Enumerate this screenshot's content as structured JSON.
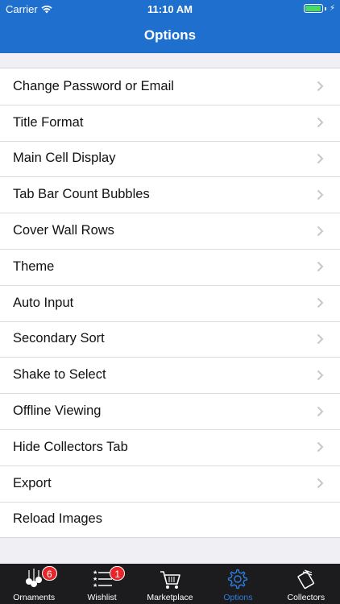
{
  "status_bar": {
    "carrier": "Carrier",
    "time": "11:10 AM",
    "battery_level": 0.95
  },
  "nav": {
    "title": "Options"
  },
  "options": [
    {
      "label": "Change Password or Email",
      "chevron": true
    },
    {
      "label": "Title Format",
      "chevron": true
    },
    {
      "label": "Main Cell Display",
      "chevron": true
    },
    {
      "label": "Tab Bar Count Bubbles",
      "chevron": true
    },
    {
      "label": "Cover Wall Rows",
      "chevron": true
    },
    {
      "label": "Theme",
      "chevron": true
    },
    {
      "label": "Auto Input",
      "chevron": true
    },
    {
      "label": "Secondary Sort",
      "chevron": true
    },
    {
      "label": "Shake to Select",
      "chevron": true
    },
    {
      "label": "Offline Viewing",
      "chevron": true
    },
    {
      "label": "Hide Collectors Tab",
      "chevron": true
    },
    {
      "label": "Export",
      "chevron": true
    },
    {
      "label": "Reload Images",
      "chevron": false
    }
  ],
  "tabs": [
    {
      "label": "Ornaments",
      "icon": "ornaments-icon",
      "badge": "6",
      "active": false
    },
    {
      "label": "Wishlist",
      "icon": "wishlist-icon",
      "badge": "1",
      "active": false
    },
    {
      "label": "Marketplace",
      "icon": "cart-icon",
      "badge": "",
      "active": false
    },
    {
      "label": "Options",
      "icon": "gear-icon",
      "badge": "",
      "active": true
    },
    {
      "label": "Collectors",
      "icon": "collectors-icon",
      "badge": "",
      "active": false
    }
  ],
  "colors": {
    "nav_bg": "#1f6fcf",
    "tab_active": "#2d7ee0",
    "badge": "#e8262a",
    "battery_fill": "#4cd964"
  }
}
